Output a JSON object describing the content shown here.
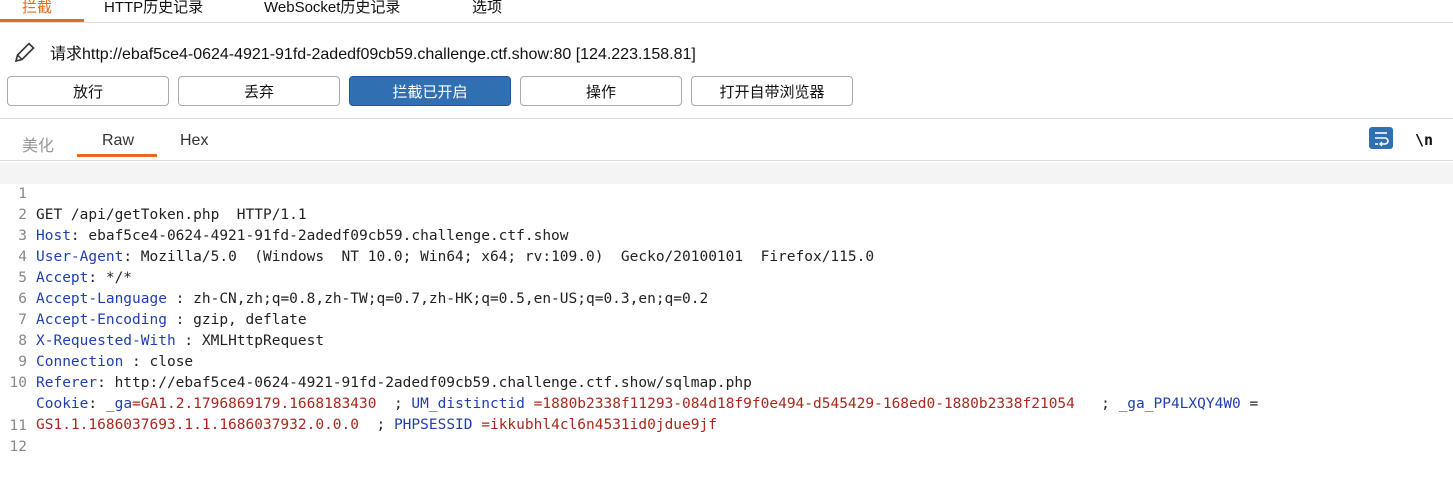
{
  "tabs": [
    "拦截",
    "HTTP历史记录",
    "WebSocket历史记录",
    "选项"
  ],
  "request_line": "请求http://ebaf5ce4-0624-4921-91fd-2adedf09cb59.challenge.ctf.show:80  [124.223.158.81]",
  "buttons": {
    "forward": "放行",
    "drop": "丢弃",
    "intercept": "拦截已开启",
    "action": "操作",
    "open_browser": "打开自带浏览器"
  },
  "view_tabs": {
    "pretty": "美化",
    "raw": "Raw",
    "hex": "Hex"
  },
  "newline_toggle": "\\n",
  "colors": {
    "accent": "#e8691f",
    "primary_button": "#2f6fb2",
    "header_name": "#1f3fb0",
    "cookie_value": "#a8281c"
  },
  "line_numbers": [
    "1",
    "2",
    "3",
    "4",
    "5",
    "6",
    "7",
    "8",
    "9",
    "10",
    "",
    "11",
    "12"
  ],
  "lines": {
    "l1": "GET /api/getToken.php  HTTP/1.1",
    "l2k": "Host",
    "l2v": ": ebaf5ce4-0624-4921-91fd-2adedf09cb59.challenge.ctf.show",
    "l3k": "User-Agent",
    "l3v": ": Mozilla/5.0  (Windows  NT 10.0; Win64; x64; rv:109.0)  Gecko/20100101  Firefox/115.0",
    "l4k": "Accept",
    "l4v": ": */*",
    "l5k": "Accept-Language",
    "l5v": " : zh-CN,zh;q=0.8,zh-TW;q=0.7,zh-HK;q=0.5,en-US;q=0.3,en;q=0.2",
    "l6k": "Accept-Encoding",
    "l6v": " : gzip, deflate",
    "l7k": "X-Requested-With",
    "l7v": " : XMLHttpRequest",
    "l8k": "Connection",
    "l8v": " : close",
    "l9k": "Referer",
    "l9v": ": http://ebaf5ce4-0624-4921-91fd-2adedf09cb59.challenge.ctf.show/sqlmap.php",
    "l10k": "Cookie",
    "l10sep1": ": ",
    "l10c1k": "_ga",
    "l10c1v": "=GA1.2.1796869179.1668183430",
    "l10sep2": "  ; ",
    "l10c2k": "UM_distinctid",
    "l10c2v": " =1880b2338f11293-084d18f9f0e494-d545429-168ed0-1880b2338f21054",
    "l10sep3": "   ; ",
    "l10c3k": "_ga_PP4LXQY4W0",
    "l10c3eq": " =",
    "l10b": "GS1.1.1686037693.1.1.1686037932.0.0.0",
    "l10sep4": "  ; ",
    "l10c4k": "PHPSESSID",
    "l10c4v": " =ikkubhl4cl6n4531id0jdue9jf"
  }
}
